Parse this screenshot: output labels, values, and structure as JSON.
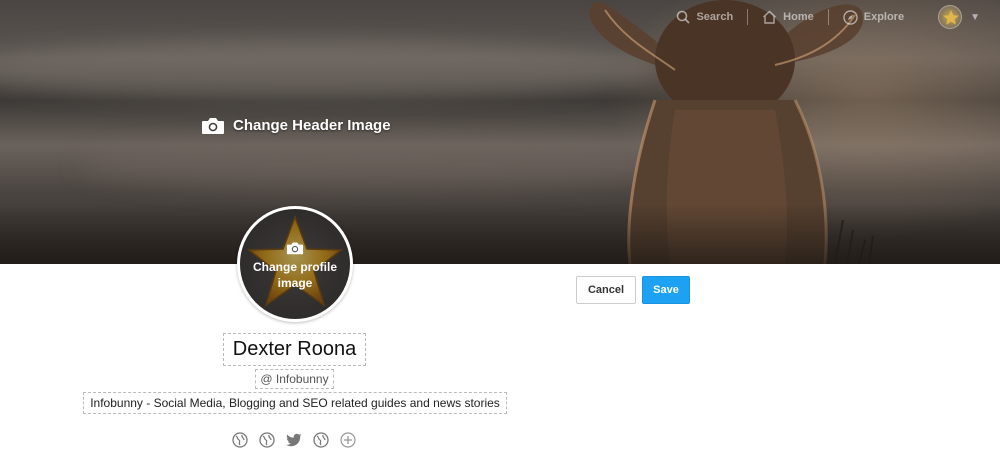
{
  "header": {
    "change_header_label": "Change Header Image"
  },
  "nav": {
    "search_label": "Search",
    "home_label": "Home",
    "explore_label": "Explore"
  },
  "profile": {
    "change_profile_label": "Change profile image",
    "display_name": "Dexter Roona",
    "handle": "@ Infobunny",
    "bio": "Infobunny - Social Media, Blogging and SEO related guides and news stories"
  },
  "actions": {
    "cancel_label": "Cancel",
    "save_label": "Save"
  },
  "social_icons": [
    "globe-icon",
    "globe-icon",
    "twitter-icon",
    "globe-icon",
    "add-icon"
  ],
  "colors": {
    "accent": "#1da1f2",
    "banner_overlay": "#3d3936"
  }
}
